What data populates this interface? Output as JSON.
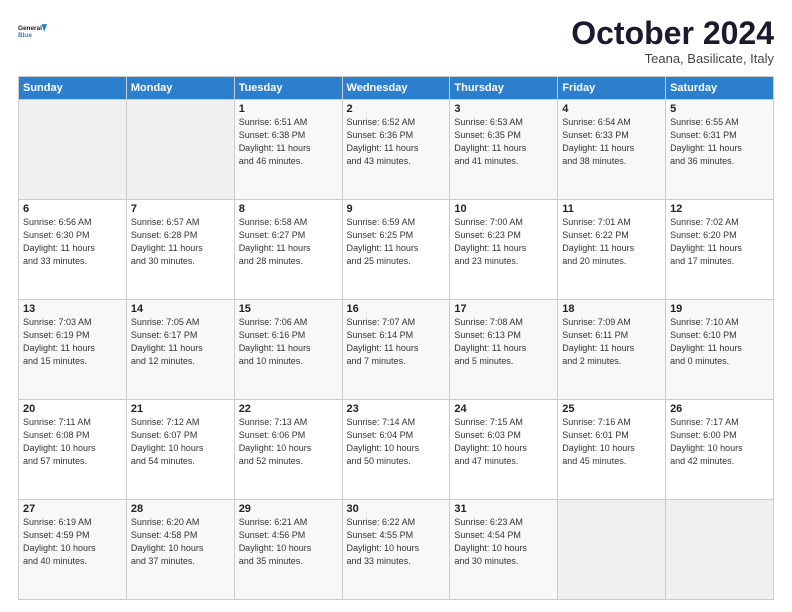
{
  "header": {
    "logo_line1": "General",
    "logo_line2": "Blue",
    "month": "October 2024",
    "location": "Teana, Basilicate, Italy"
  },
  "weekdays": [
    "Sunday",
    "Monday",
    "Tuesday",
    "Wednesday",
    "Thursday",
    "Friday",
    "Saturday"
  ],
  "weeks": [
    [
      {
        "day": "",
        "info": ""
      },
      {
        "day": "",
        "info": ""
      },
      {
        "day": "1",
        "info": "Sunrise: 6:51 AM\nSunset: 6:38 PM\nDaylight: 11 hours\nand 46 minutes."
      },
      {
        "day": "2",
        "info": "Sunrise: 6:52 AM\nSunset: 6:36 PM\nDaylight: 11 hours\nand 43 minutes."
      },
      {
        "day": "3",
        "info": "Sunrise: 6:53 AM\nSunset: 6:35 PM\nDaylight: 11 hours\nand 41 minutes."
      },
      {
        "day": "4",
        "info": "Sunrise: 6:54 AM\nSunset: 6:33 PM\nDaylight: 11 hours\nand 38 minutes."
      },
      {
        "day": "5",
        "info": "Sunrise: 6:55 AM\nSunset: 6:31 PM\nDaylight: 11 hours\nand 36 minutes."
      }
    ],
    [
      {
        "day": "6",
        "info": "Sunrise: 6:56 AM\nSunset: 6:30 PM\nDaylight: 11 hours\nand 33 minutes."
      },
      {
        "day": "7",
        "info": "Sunrise: 6:57 AM\nSunset: 6:28 PM\nDaylight: 11 hours\nand 30 minutes."
      },
      {
        "day": "8",
        "info": "Sunrise: 6:58 AM\nSunset: 6:27 PM\nDaylight: 11 hours\nand 28 minutes."
      },
      {
        "day": "9",
        "info": "Sunrise: 6:59 AM\nSunset: 6:25 PM\nDaylight: 11 hours\nand 25 minutes."
      },
      {
        "day": "10",
        "info": "Sunrise: 7:00 AM\nSunset: 6:23 PM\nDaylight: 11 hours\nand 23 minutes."
      },
      {
        "day": "11",
        "info": "Sunrise: 7:01 AM\nSunset: 6:22 PM\nDaylight: 11 hours\nand 20 minutes."
      },
      {
        "day": "12",
        "info": "Sunrise: 7:02 AM\nSunset: 6:20 PM\nDaylight: 11 hours\nand 17 minutes."
      }
    ],
    [
      {
        "day": "13",
        "info": "Sunrise: 7:03 AM\nSunset: 6:19 PM\nDaylight: 11 hours\nand 15 minutes."
      },
      {
        "day": "14",
        "info": "Sunrise: 7:05 AM\nSunset: 6:17 PM\nDaylight: 11 hours\nand 12 minutes."
      },
      {
        "day": "15",
        "info": "Sunrise: 7:06 AM\nSunset: 6:16 PM\nDaylight: 11 hours\nand 10 minutes."
      },
      {
        "day": "16",
        "info": "Sunrise: 7:07 AM\nSunset: 6:14 PM\nDaylight: 11 hours\nand 7 minutes."
      },
      {
        "day": "17",
        "info": "Sunrise: 7:08 AM\nSunset: 6:13 PM\nDaylight: 11 hours\nand 5 minutes."
      },
      {
        "day": "18",
        "info": "Sunrise: 7:09 AM\nSunset: 6:11 PM\nDaylight: 11 hours\nand 2 minutes."
      },
      {
        "day": "19",
        "info": "Sunrise: 7:10 AM\nSunset: 6:10 PM\nDaylight: 11 hours\nand 0 minutes."
      }
    ],
    [
      {
        "day": "20",
        "info": "Sunrise: 7:11 AM\nSunset: 6:08 PM\nDaylight: 10 hours\nand 57 minutes."
      },
      {
        "day": "21",
        "info": "Sunrise: 7:12 AM\nSunset: 6:07 PM\nDaylight: 10 hours\nand 54 minutes."
      },
      {
        "day": "22",
        "info": "Sunrise: 7:13 AM\nSunset: 6:06 PM\nDaylight: 10 hours\nand 52 minutes."
      },
      {
        "day": "23",
        "info": "Sunrise: 7:14 AM\nSunset: 6:04 PM\nDaylight: 10 hours\nand 50 minutes."
      },
      {
        "day": "24",
        "info": "Sunrise: 7:15 AM\nSunset: 6:03 PM\nDaylight: 10 hours\nand 47 minutes."
      },
      {
        "day": "25",
        "info": "Sunrise: 7:16 AM\nSunset: 6:01 PM\nDaylight: 10 hours\nand 45 minutes."
      },
      {
        "day": "26",
        "info": "Sunrise: 7:17 AM\nSunset: 6:00 PM\nDaylight: 10 hours\nand 42 minutes."
      }
    ],
    [
      {
        "day": "27",
        "info": "Sunrise: 6:19 AM\nSunset: 4:59 PM\nDaylight: 10 hours\nand 40 minutes."
      },
      {
        "day": "28",
        "info": "Sunrise: 6:20 AM\nSunset: 4:58 PM\nDaylight: 10 hours\nand 37 minutes."
      },
      {
        "day": "29",
        "info": "Sunrise: 6:21 AM\nSunset: 4:56 PM\nDaylight: 10 hours\nand 35 minutes."
      },
      {
        "day": "30",
        "info": "Sunrise: 6:22 AM\nSunset: 4:55 PM\nDaylight: 10 hours\nand 33 minutes."
      },
      {
        "day": "31",
        "info": "Sunrise: 6:23 AM\nSunset: 4:54 PM\nDaylight: 10 hours\nand 30 minutes."
      },
      {
        "day": "",
        "info": ""
      },
      {
        "day": "",
        "info": ""
      }
    ]
  ]
}
